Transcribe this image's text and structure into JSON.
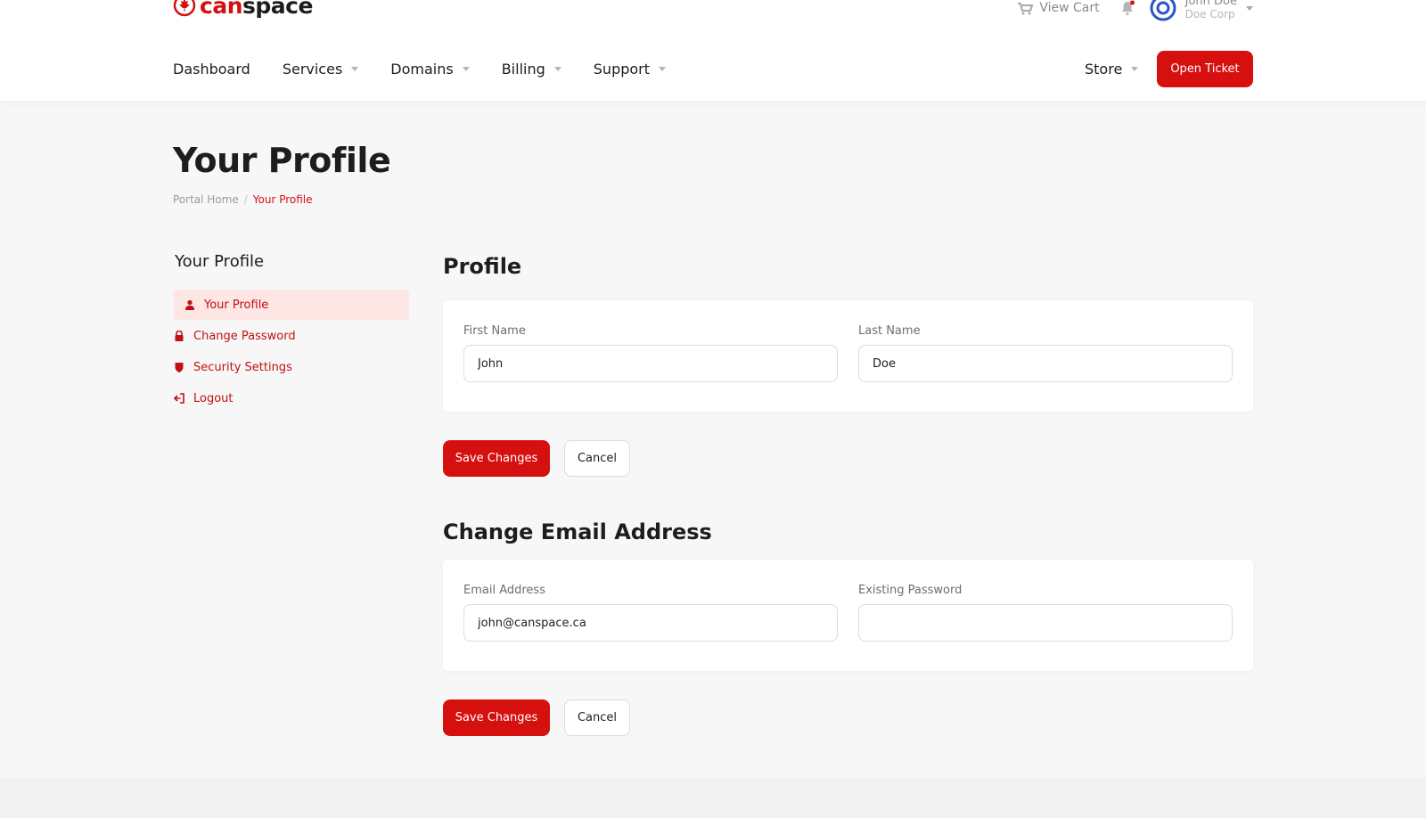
{
  "brand": {
    "part1": "can",
    "part2": "space",
    "accent": "#d60f0f"
  },
  "header": {
    "view_cart": "View Cart",
    "user_name": "John Doe",
    "user_company": "Doe Corp"
  },
  "nav": {
    "items": [
      {
        "label": "Dashboard",
        "dropdown": false
      },
      {
        "label": "Services",
        "dropdown": true
      },
      {
        "label": "Domains",
        "dropdown": true
      },
      {
        "label": "Billing",
        "dropdown": true
      },
      {
        "label": "Support",
        "dropdown": true
      }
    ],
    "store": "Store",
    "open_ticket": "Open Ticket"
  },
  "page": {
    "title": "Your Profile",
    "breadcrumb": {
      "home": "Portal Home",
      "sep": "/",
      "current": "Your Profile"
    }
  },
  "sidebar": {
    "title": "Your Profile",
    "items": [
      {
        "label": "Your Profile",
        "icon": "user-icon",
        "active": true
      },
      {
        "label": "Change Password",
        "icon": "lock-icon"
      },
      {
        "label": "Security Settings",
        "icon": "shield-icon"
      },
      {
        "label": "Logout",
        "icon": "logout-icon"
      }
    ]
  },
  "profile": {
    "title": "Profile",
    "first_name_label": "First Name",
    "first_name_value": "John",
    "last_name_label": "Last Name",
    "last_name_value": "Doe",
    "save": "Save Changes",
    "cancel": "Cancel"
  },
  "email": {
    "title": "Change Email Address",
    "email_label": "Email Address",
    "email_value": "john@canspace.ca",
    "password_label": "Existing Password",
    "password_value": "",
    "save": "Save Changes",
    "cancel": "Cancel"
  }
}
